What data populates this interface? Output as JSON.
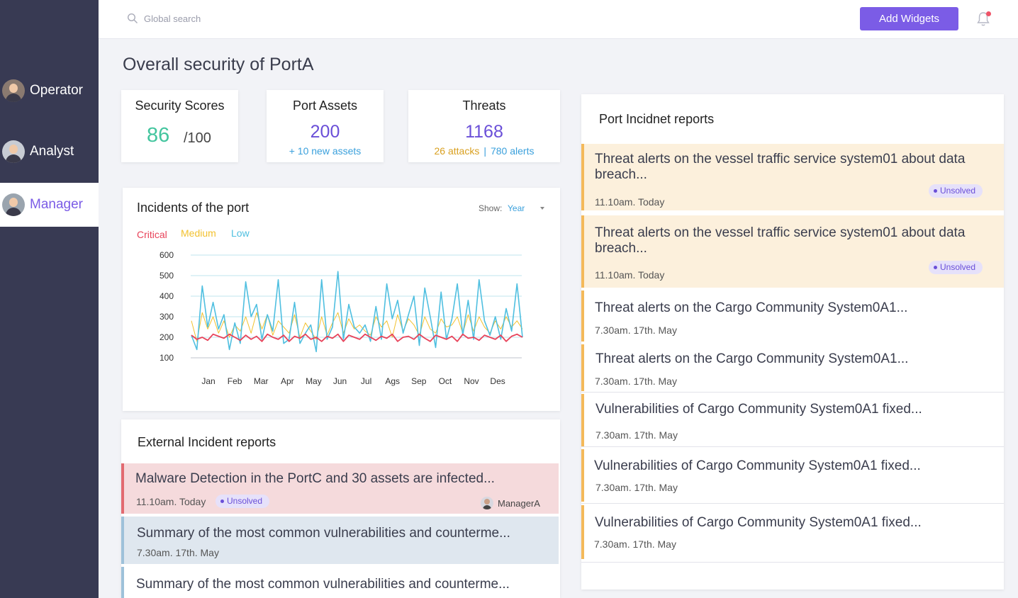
{
  "sidebar": {
    "roles": [
      {
        "label": "Operator",
        "active": false
      },
      {
        "label": "Analyst",
        "active": false
      },
      {
        "label": "Manager",
        "active": true
      }
    ]
  },
  "topbar": {
    "search_placeholder": "Global search",
    "add_widgets_label": "Add Widgets"
  },
  "page": {
    "title": "Overall security of PortA"
  },
  "stats": {
    "security": {
      "title": "Security Scores",
      "value": "86",
      "max": "/100"
    },
    "assets": {
      "title": "Port Assets",
      "value": "200",
      "sub": "+ 10 new assets"
    },
    "threats": {
      "title": "Threats",
      "value": "1168",
      "attacks": "26 attacks",
      "sep": "|",
      "alerts": "780 alerts"
    }
  },
  "incidents": {
    "title": "Incidents of the port",
    "show_label": "Show:",
    "show_value": "Year",
    "legend": [
      {
        "name": "Critical",
        "color": "#e8435a"
      },
      {
        "name": "Medium",
        "color": "#f2c12e"
      },
      {
        "name": "Low",
        "color": "#4fbfe0"
      }
    ]
  },
  "chart_data": {
    "type": "line",
    "categories": [
      "Jan",
      "Feb",
      "Mar",
      "Apr",
      "May",
      "Jun",
      "Jul",
      "Ags",
      "Sep",
      "Oct",
      "Nov",
      "Des"
    ],
    "y_ticks": [
      600,
      500,
      400,
      300,
      200,
      100
    ],
    "ylim": [
      100,
      600
    ],
    "grid": true,
    "legend_placement": "top-left",
    "series": [
      {
        "name": "Low",
        "color": "#4fbfe0",
        "values": [
          210,
          140,
          450,
          250,
          370,
          240,
          310,
          140,
          270,
          170,
          470,
          300,
          360,
          190,
          310,
          230,
          480,
          170,
          190,
          370,
          170,
          220,
          260,
          130,
          480,
          190,
          250,
          520,
          190,
          360,
          250,
          220,
          260,
          180,
          350,
          190,
          460,
          290,
          380,
          220,
          310,
          400,
          160,
          440,
          300,
          150,
          420,
          190,
          290,
          460,
          210,
          380,
          190,
          480,
          280,
          210,
          300,
          190,
          340,
          230,
          460,
          200
        ]
      },
      {
        "name": "Medium",
        "color": "#f2c12e",
        "values": [
          280,
          180,
          320,
          240,
          300,
          220,
          280,
          200,
          260,
          230,
          300,
          220,
          320,
          240,
          310,
          210,
          280,
          250,
          220,
          310,
          200,
          270,
          230,
          190,
          300,
          210,
          270,
          320,
          220,
          290,
          240,
          260,
          230,
          210,
          300,
          250,
          280,
          200,
          310,
          230,
          290,
          260,
          210,
          300,
          240,
          220,
          290,
          250,
          260,
          300,
          220,
          310,
          230,
          300,
          250,
          220,
          280,
          240,
          300,
          250,
          280,
          240
        ]
      },
      {
        "name": "Critical",
        "color": "#e8435a",
        "values": [
          210,
          190,
          200,
          185,
          215,
          205,
          195,
          215,
          200,
          185,
          210,
          190,
          205,
          180,
          215,
          200,
          190,
          210,
          180,
          205,
          195,
          215,
          190,
          200,
          180,
          205,
          195,
          215,
          180,
          210,
          200,
          190,
          215,
          200,
          185,
          205,
          195,
          215,
          180,
          200,
          205,
          190,
          215,
          195,
          180,
          210,
          200,
          190,
          205,
          180,
          215,
          195,
          200,
          185,
          210,
          200,
          190,
          210,
          180,
          205,
          215,
          200
        ]
      }
    ]
  },
  "external": {
    "title": "External Incident reports",
    "items": [
      {
        "title": "Malware Detection in the PortC and 30 assets are infected...",
        "time": "11.10am. Today",
        "status": "Unsolved",
        "manager": "ManagerA"
      },
      {
        "title": "Summary of the most common vulnerabilities and counterme...",
        "time": "7.30am. 17th. May"
      },
      {
        "title": "Summary of the most common vulnerabilities and counterme..."
      }
    ]
  },
  "port_reports": {
    "title": "Port Incidnet reports",
    "items": [
      {
        "title": "Threat alerts on the vessel traffic service system01 about data  breach...",
        "time": "11.10am. Today",
        "status": "Unsolved"
      },
      {
        "title": "Threat alerts on the vessel traffic service system01 about data  breach...",
        "time": "11.10am. Today",
        "status": "Unsolved"
      },
      {
        "title": "Threat alerts on the Cargo Community System0A1...",
        "time": "7.30am. 17th. May"
      },
      {
        "title": "Threat alerts on the Cargo Community System0A1...",
        "time": "7.30am. 17th. May"
      },
      {
        "title": "Vulnerabilities of Cargo Community System0A1 fixed...",
        "time": "7.30am. 17th. May"
      },
      {
        "title": "Vulnerabilities of Cargo Community System0A1 fixed...",
        "time": "7.30am. 17th. May"
      },
      {
        "title": "Vulnerabilities of Cargo Community System0A1 fixed...",
        "time": "7.30am. 17th. May"
      }
    ]
  },
  "colors": {
    "sidebar_bg": "#383a53",
    "accent": "#7b5ce6",
    "score_green": "#43c59e",
    "alert_blue": "#3aa0dc",
    "attack_orange": "#d9a020",
    "report_border": "#f4b95a",
    "report_highlight": "#fcf0dc",
    "unsolved_badge": "#e6e1fa",
    "critical_bg": "#f5dadc",
    "critical_border": "#e26a70",
    "summary_bg": "#dfe7ef",
    "summary_border": "#9ec1da"
  }
}
